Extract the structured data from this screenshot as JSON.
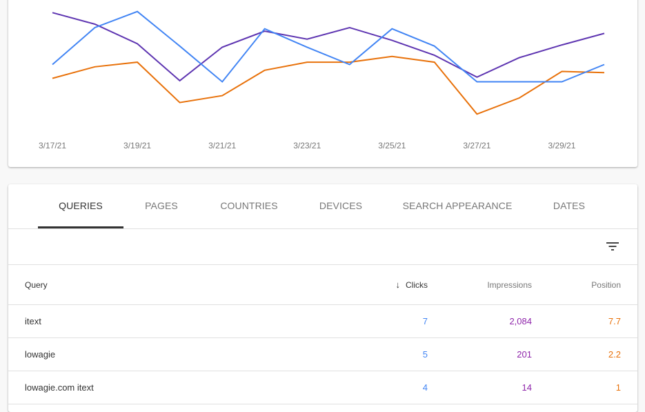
{
  "colors": {
    "clicks": "#4285f4",
    "impressions": "#5e35b1",
    "impressions_text": "#8e24aa",
    "position": "#e8710a"
  },
  "chart_data": {
    "type": "line",
    "title": "",
    "xlabel": "",
    "ylabel": "",
    "normalized": true,
    "note": "Y axes hidden; values are relative (0 = bottom, 1 = top of plot area), each series independently scaled",
    "x": [
      "3/17/21",
      "3/18/21",
      "3/19/21",
      "3/20/21",
      "3/21/21",
      "3/22/21",
      "3/23/21",
      "3/24/21",
      "3/25/21",
      "3/26/21",
      "3/27/21",
      "3/28/21",
      "3/29/21",
      "3/30/21"
    ],
    "x_tick_labels": [
      "3/17/21",
      "3/19/21",
      "3/21/21",
      "3/23/21",
      "3/25/21",
      "3/27/21",
      "3/29/21"
    ],
    "ylim": [
      0,
      1
    ],
    "grid": false,
    "legend": "none",
    "series": [
      {
        "name": "Clicks",
        "color": "#4285f4",
        "values": [
          0.56,
          0.88,
          1.02,
          0.72,
          0.41,
          0.87,
          0.71,
          0.56,
          0.87,
          0.72,
          0.41,
          0.41,
          0.41,
          0.56
        ]
      },
      {
        "name": "Impressions",
        "color": "#5e35b1",
        "values": [
          1.01,
          0.91,
          0.74,
          0.42,
          0.71,
          0.85,
          0.78,
          0.88,
          0.77,
          0.64,
          0.45,
          0.62,
          0.73,
          0.83
        ]
      },
      {
        "name": "Position",
        "color": "#e8710a",
        "values": [
          0.44,
          0.54,
          0.58,
          0.23,
          0.29,
          0.51,
          0.58,
          0.58,
          0.63,
          0.58,
          0.13,
          0.27,
          0.5,
          0.49
        ]
      }
    ]
  },
  "tabs": [
    {
      "label": "QUERIES",
      "active": true
    },
    {
      "label": "PAGES",
      "active": false
    },
    {
      "label": "COUNTRIES",
      "active": false
    },
    {
      "label": "DEVICES",
      "active": false
    },
    {
      "label": "SEARCH APPEARANCE",
      "active": false
    },
    {
      "label": "DATES",
      "active": false
    }
  ],
  "toolbar": {
    "filter_icon": "filter-list-icon"
  },
  "table": {
    "headers": {
      "query": "Query",
      "clicks": "Clicks",
      "impressions": "Impressions",
      "position": "Position",
      "sort_icon": "↓"
    },
    "rows": [
      {
        "query": "itext",
        "clicks": "7",
        "impressions": "2,084",
        "position": "7.7"
      },
      {
        "query": "lowagie",
        "clicks": "5",
        "impressions": "201",
        "position": "2.2"
      },
      {
        "query": "lowagie.com itext",
        "clicks": "4",
        "impressions": "14",
        "position": "1"
      }
    ]
  }
}
